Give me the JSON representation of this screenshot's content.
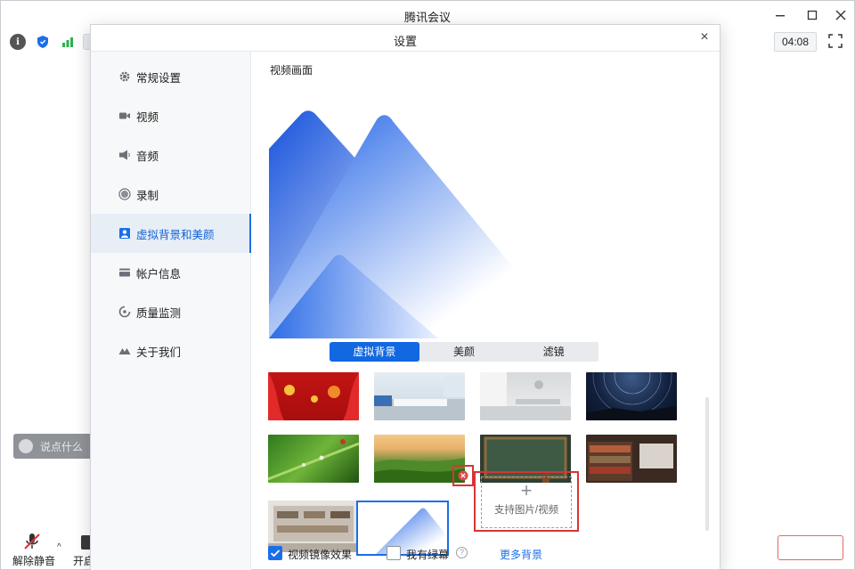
{
  "window": {
    "title": "腾讯会议",
    "timer": "04:08"
  },
  "meeting": {
    "chat_placeholder": "说点什么",
    "mute_label": "解除静音",
    "video_label": "开启"
  },
  "dialog": {
    "title": "设置",
    "close_glyph": "×"
  },
  "sidebar": {
    "items": [
      {
        "label": "常规设置",
        "icon": "gear-icon"
      },
      {
        "label": "视频",
        "icon": "video-camera-icon"
      },
      {
        "label": "音频",
        "icon": "speaker-icon"
      },
      {
        "label": "录制",
        "icon": "record-icon"
      },
      {
        "label": "虚拟背景和美颜",
        "icon": "person-portrait-icon",
        "active": true
      },
      {
        "label": "帐户信息",
        "icon": "card-icon"
      },
      {
        "label": "质量监测",
        "icon": "monitor-icon"
      },
      {
        "label": "关于我们",
        "icon": "logo-icon"
      }
    ]
  },
  "content": {
    "section_label": "视频画面",
    "tabs": [
      "虚拟背景",
      "美颜",
      "滤镜"
    ],
    "active_tab": 0,
    "backgrounds": [
      "red-festival-background",
      "office-meeting-room-background",
      "white-room-background",
      "star-trails-background",
      "green-leaf-dew-background",
      "green-hills-background",
      "chalkboard-background",
      "bookshelf-room-background",
      "study-shelf-background",
      "tencent-meeting-default-background"
    ],
    "add_label": "支持图片/视频",
    "add_glyph": "+",
    "mirror_label": "视频镜像效果",
    "mirror_checked": true,
    "greenscreen_label": "我有绿幕",
    "greenscreen_checked": false,
    "help_glyph": "?",
    "more_label": "更多背景"
  },
  "colors": {
    "accent": "#1a6ee9",
    "highlight_red": "#d93434",
    "sidebar_active_bg": "#e8eef6"
  }
}
